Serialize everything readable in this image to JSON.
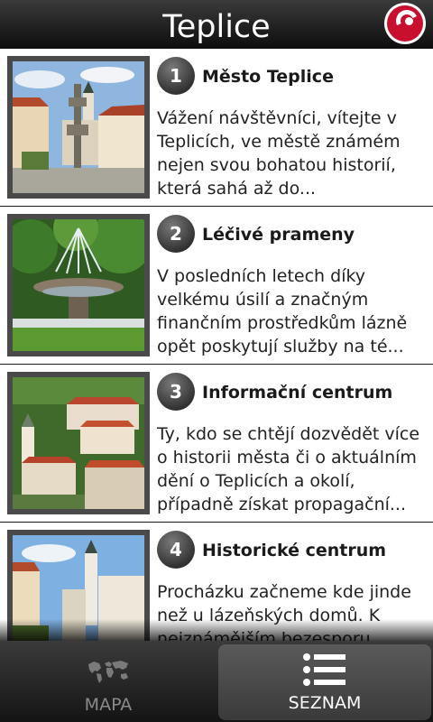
{
  "header": {
    "title": "Teplice"
  },
  "items": [
    {
      "number": "1",
      "title": "Město Teplice",
      "description": "Vážení návštěvníci, vítejte v Teplicích, ve městě známém nejen svou bohatou historií, která sahá až do..."
    },
    {
      "number": "2",
      "title": "Léčivé prameny",
      "description": "V posledních letech díky velkému úsilí a značným finančním prostředkům lázně opět poskytují služby na té..."
    },
    {
      "number": "3",
      "title": "Informační centrum",
      "description": "Ty, kdo se chtějí dozvědět více o historii města či o aktuálním dění o Teplicích a okolí, případně získat propagační..."
    },
    {
      "number": "4",
      "title": "Historické centrum",
      "description": "Procházku začneme kde jinde než u lázeňských domů. K nejznámějším bezesporu..."
    }
  ],
  "nav": {
    "map_label": "MAPA",
    "list_label": "SEZNAM"
  },
  "colors": {
    "header_bg": "#1a1a1a",
    "logo_red": "#c8102e",
    "divider": "#1a1a1a",
    "nav_active": "#4a4a4a"
  },
  "icons": {
    "logo": "teplice-logo-icon",
    "map": "world-map-icon",
    "list": "list-icon"
  }
}
